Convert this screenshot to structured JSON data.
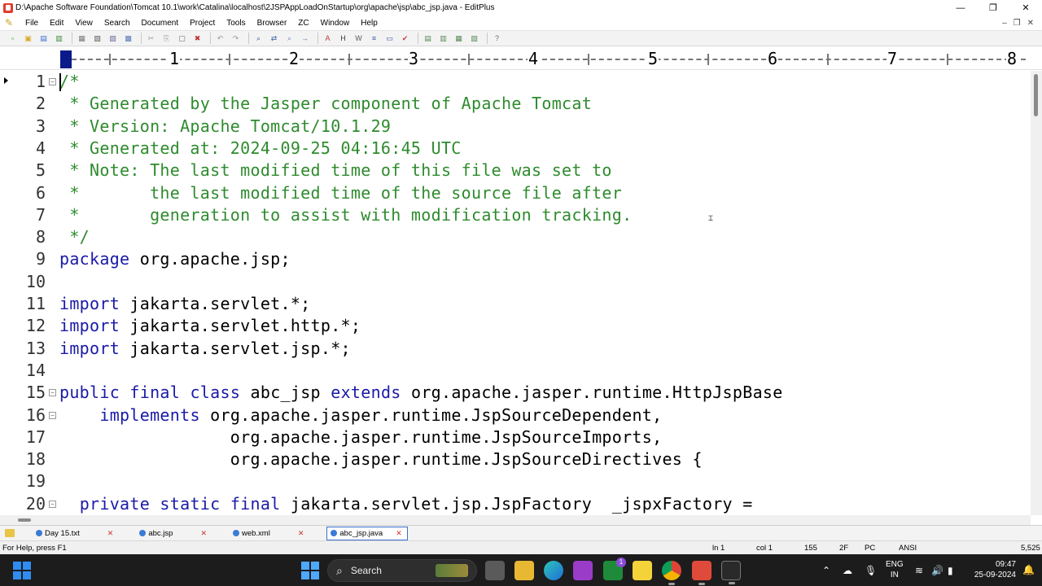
{
  "window": {
    "title": "D:\\Apache Software Foundation\\Tomcat 10.1\\work\\Catalina\\localhost\\2JSPAppLoadOnStartup\\org\\apache\\jsp\\abc_jsp.java - EditPlus",
    "minimize": "—",
    "maximize": "❐",
    "close": "✕"
  },
  "menu": {
    "items": [
      "File",
      "Edit",
      "View",
      "Search",
      "Document",
      "Project",
      "Tools",
      "Browser",
      "ZC",
      "Window",
      "Help"
    ],
    "mdi_minimize": "–",
    "mdi_restore": "❐",
    "mdi_close": "✕"
  },
  "toolbar": {
    "buttons": [
      {
        "icon": "new-icon",
        "color": "#3aa13a"
      },
      {
        "icon": "open-icon",
        "color": "#d9a828"
      },
      {
        "icon": "save-icon",
        "color": "#3a6fd0"
      },
      {
        "icon": "save-all-icon",
        "color": "#3a8a3a"
      },
      {
        "icon": "print-preview-icon",
        "color": "#7a7a7a"
      },
      {
        "icon": "print-icon",
        "color": "#5a5a5a"
      },
      {
        "icon": "spell-icon",
        "color": "#6a6a9a"
      },
      {
        "icon": "browser-preview-icon",
        "color": "#5a7aba"
      },
      {
        "icon": "cut-icon",
        "color": "#9a9a9a"
      },
      {
        "icon": "copy-icon",
        "color": "#9a9a9a"
      },
      {
        "icon": "paste-icon",
        "color": "#6a6a6a"
      },
      {
        "icon": "delete-icon",
        "color": "#c03030"
      },
      {
        "icon": "undo-icon",
        "color": "#9a9a9a"
      },
      {
        "icon": "redo-icon",
        "color": "#9a9a9a"
      },
      {
        "icon": "find-icon",
        "color": "#3a5aa0"
      },
      {
        "icon": "replace-icon",
        "color": "#3a5aa0"
      },
      {
        "icon": "find-in-files-icon",
        "color": "#6a8ab0"
      },
      {
        "icon": "goto-icon",
        "color": "#5a7ab0"
      },
      {
        "icon": "font-icon",
        "color": "#c03a3a"
      },
      {
        "icon": "hex-icon",
        "color": "#3a3a3a"
      },
      {
        "icon": "word-wrap-icon",
        "color": "#5a5a5a"
      },
      {
        "icon": "line-number-icon",
        "color": "#3a5aa0"
      },
      {
        "icon": "ruler-icon",
        "color": "#3a5aa0"
      },
      {
        "icon": "check-icon",
        "color": "#d04040"
      },
      {
        "icon": "cliptext-icon",
        "color": "#5a8a5a"
      },
      {
        "icon": "directory-icon",
        "color": "#5a8a5a"
      },
      {
        "icon": "output-icon",
        "color": "#5a8a5a"
      },
      {
        "icon": "full-screen-icon",
        "color": "#5a8a5a"
      },
      {
        "icon": "help-icon",
        "color": "#6a6a6a"
      }
    ]
  },
  "ruler": {
    "numbers": [
      "1",
      "2",
      "3",
      "4",
      "5",
      "6",
      "7",
      "8"
    ]
  },
  "editor": {
    "lines": [
      {
        "num": "1",
        "fold": "⊟",
        "segments": [
          {
            "t": "/*",
            "c": "comment"
          }
        ]
      },
      {
        "num": "2",
        "fold": "",
        "segments": [
          {
            "t": " * Generated by the Jasper component of Apache Tomcat",
            "c": "comment"
          }
        ]
      },
      {
        "num": "3",
        "fold": "",
        "segments": [
          {
            "t": " * Version: Apache Tomcat/10.1.29",
            "c": "comment"
          }
        ]
      },
      {
        "num": "4",
        "fold": "",
        "segments": [
          {
            "t": " * Generated at: 2024-09-25 04:16:45 UTC",
            "c": "comment"
          }
        ]
      },
      {
        "num": "5",
        "fold": "",
        "segments": [
          {
            "t": " * Note: The last modified time of this file was set to",
            "c": "comment"
          }
        ]
      },
      {
        "num": "6",
        "fold": "",
        "segments": [
          {
            "t": " *       the last modified time of the source file after",
            "c": "comment"
          }
        ]
      },
      {
        "num": "7",
        "fold": "",
        "segments": [
          {
            "t": " *       generation to assist with modification tracking.",
            "c": "comment"
          }
        ]
      },
      {
        "num": "8",
        "fold": "",
        "segments": [
          {
            "t": " */",
            "c": "comment"
          }
        ]
      },
      {
        "num": "9",
        "fold": "",
        "segments": [
          {
            "t": "package",
            "c": "kw"
          },
          {
            "t": " org.apache.jsp;",
            "c": "plain"
          }
        ]
      },
      {
        "num": "10",
        "fold": "",
        "segments": []
      },
      {
        "num": "11",
        "fold": "",
        "segments": [
          {
            "t": "import",
            "c": "kw"
          },
          {
            "t": " jakarta.servlet.*;",
            "c": "plain"
          }
        ]
      },
      {
        "num": "12",
        "fold": "",
        "segments": [
          {
            "t": "import",
            "c": "kw"
          },
          {
            "t": " jakarta.servlet.http.*;",
            "c": "plain"
          }
        ]
      },
      {
        "num": "13",
        "fold": "",
        "segments": [
          {
            "t": "import",
            "c": "kw"
          },
          {
            "t": " jakarta.servlet.jsp.*;",
            "c": "plain"
          }
        ]
      },
      {
        "num": "14",
        "fold": "",
        "segments": []
      },
      {
        "num": "15",
        "fold": "⊟",
        "segments": [
          {
            "t": "public",
            "c": "kw"
          },
          {
            "t": " ",
            "c": "plain"
          },
          {
            "t": "final",
            "c": "kw"
          },
          {
            "t": " ",
            "c": "plain"
          },
          {
            "t": "class",
            "c": "kw"
          },
          {
            "t": " abc_jsp ",
            "c": "plain"
          },
          {
            "t": "extends",
            "c": "kw"
          },
          {
            "t": " org.apache.jasper.runtime.HttpJspBase",
            "c": "plain"
          }
        ]
      },
      {
        "num": "16",
        "fold": "⊟",
        "segments": [
          {
            "t": "    ",
            "c": "plain"
          },
          {
            "t": "implements",
            "c": "kw"
          },
          {
            "t": " org.apache.jasper.runtime.JspSourceDependent,",
            "c": "plain"
          }
        ]
      },
      {
        "num": "17",
        "fold": "",
        "segments": [
          {
            "t": "                 org.apache.jasper.runtime.JspSourceImports,",
            "c": "plain"
          }
        ]
      },
      {
        "num": "18",
        "fold": "",
        "segments": [
          {
            "t": "                 org.apache.jasper.runtime.JspSourceDirectives {",
            "c": "plain"
          }
        ]
      },
      {
        "num": "19",
        "fold": "",
        "segments": []
      },
      {
        "num": "20",
        "fold": "⊟",
        "segments": [
          {
            "t": "  ",
            "c": "plain"
          },
          {
            "t": "private",
            "c": "kw"
          },
          {
            "t": " ",
            "c": "plain"
          },
          {
            "t": "static",
            "c": "kw"
          },
          {
            "t": " ",
            "c": "plain"
          },
          {
            "t": "final",
            "c": "kw"
          },
          {
            "t": " jakarta.servlet.jsp.JspFactory  _jspxFactory =",
            "c": "plain"
          }
        ]
      }
    ]
  },
  "tabs": [
    {
      "label": "Day 15.txt",
      "close": "✕",
      "active": false
    },
    {
      "label": "abc.jsp",
      "close": "✕",
      "active": false
    },
    {
      "label": "web.xml",
      "close": "✕",
      "active": false
    },
    {
      "label": "abc_jsp.java",
      "close": "✕",
      "active": true
    }
  ],
  "status": {
    "help": "For Help, press F1",
    "line": "ln 1",
    "col": "col 1",
    "lines_total": "155",
    "mode": "2F",
    "platform": "PC",
    "encoding": "ANSI",
    "size": "5,525"
  },
  "taskbar": {
    "search_label": "Search",
    "lang_top": "ENG",
    "lang_bottom": "IN",
    "time": "09:47",
    "date": "25-09-2024",
    "badge_count": "1"
  },
  "colors": {
    "comment": "#2e8b2e",
    "keyword": "#1a1aa8",
    "tab_active_border": "#3b6fd0"
  }
}
